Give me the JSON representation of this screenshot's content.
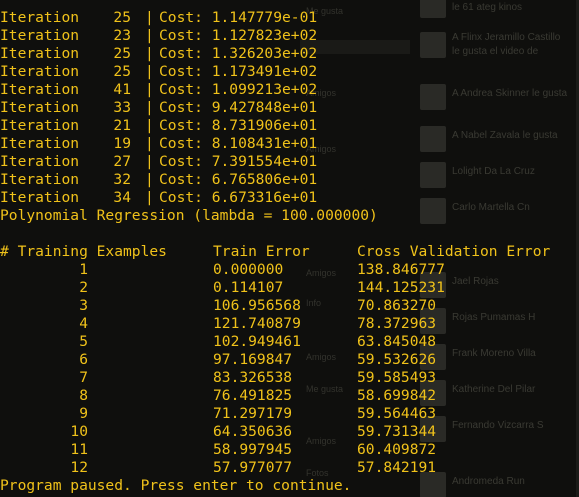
{
  "terminal": {
    "iterations": [
      {
        "label": "Iteration",
        "num": "25",
        "cost": "Cost: 1.147779e-01"
      },
      {
        "label": "Iteration",
        "num": "23",
        "cost": "Cost: 1.127823e+02"
      },
      {
        "label": "Iteration",
        "num": "25",
        "cost": "Cost: 1.326203e+02"
      },
      {
        "label": "Iteration",
        "num": "25",
        "cost": "Cost: 1.173491e+02"
      },
      {
        "label": "Iteration",
        "num": "41",
        "cost": "Cost: 1.099213e+02"
      },
      {
        "label": "Iteration",
        "num": "33",
        "cost": "Cost: 9.427848e+01"
      },
      {
        "label": "Iteration",
        "num": "21",
        "cost": "Cost: 8.731906e+01"
      },
      {
        "label": "Iteration",
        "num": "19",
        "cost": "Cost: 8.108431e+01"
      },
      {
        "label": "Iteration",
        "num": "27",
        "cost": "Cost: 7.391554e+01"
      },
      {
        "label": "Iteration",
        "num": "32",
        "cost": "Cost: 6.765806e+01"
      },
      {
        "label": "Iteration",
        "num": "34",
        "cost": "Cost: 6.673316e+01"
      }
    ],
    "separator": "|",
    "title": "Polynomial Regression (lambda = 100.000000)",
    "headers": {
      "examples": "# Training Examples",
      "train": "Train Error",
      "cv": "Cross Validation Error"
    },
    "rows": [
      {
        "n": "1",
        "train": "0.000000",
        "cv": "138.846777"
      },
      {
        "n": "2",
        "train": "0.114107",
        "cv": "144.125231"
      },
      {
        "n": "3",
        "train": "106.956568",
        "cv": "70.863270"
      },
      {
        "n": "4",
        "train": "121.740879",
        "cv": "78.372963"
      },
      {
        "n": "5",
        "train": "102.949461",
        "cv": "63.845048"
      },
      {
        "n": "6",
        "train": "97.169847",
        "cv": "59.532626"
      },
      {
        "n": "7",
        "train": "83.326538",
        "cv": "59.585493"
      },
      {
        "n": "8",
        "train": "76.491825",
        "cv": "58.699842"
      },
      {
        "n": "9",
        "train": "71.297179",
        "cv": "59.564463"
      },
      {
        "n": "10",
        "train": "64.350636",
        "cv": "59.731344"
      },
      {
        "n": "11",
        "train": "58.997945",
        "cv": "60.409872"
      },
      {
        "n": "12",
        "train": "57.977077",
        "cv": "57.842191"
      }
    ],
    "footer": "Program paused. Press enter to continue."
  },
  "background_page": {
    "items": [
      "le 61 ateg kinos",
      "A Flinx Jeramillo Castillo",
      "le gusta el video de",
      "A Andrea Skinner le gusta",
      "A Nabel Zavala le gusta",
      "Lolight Da La Cruz",
      "Carlo Martella Cn",
      "Jael Rojas",
      "Rojas Pumamas H",
      "Frank Moreno Villa",
      "Katherine Del Pilar",
      "Fernando Vizcarra S",
      "Andromeda Run"
    ],
    "left_items": [
      "Me gusta",
      "Amigos",
      "Amigos",
      "Amigos",
      "Info",
      "Amigos",
      "Me gusta",
      "Amigos",
      "Fotos"
    ]
  },
  "colors": {
    "terminal_text": "#f0c21a",
    "background": "#0f0f0d"
  }
}
